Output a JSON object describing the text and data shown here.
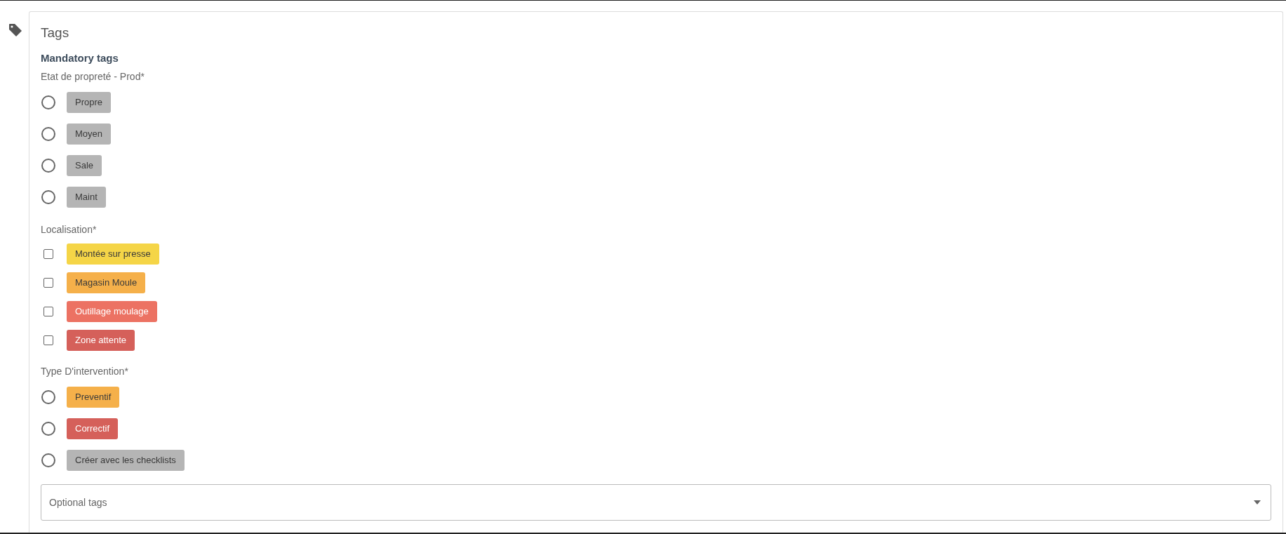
{
  "section": {
    "title": "Tags",
    "subtitle": "Mandatory tags"
  },
  "groups": [
    {
      "label": "Etat de propreté - Prod*",
      "kind": "radio",
      "options": [
        {
          "label": "Propre",
          "color": "#b5b5b5",
          "selected": false
        },
        {
          "label": "Moyen",
          "color": "#b5b5b5",
          "selected": false
        },
        {
          "label": "Sale",
          "color": "#b5b5b5",
          "selected": false
        },
        {
          "label": "Maint",
          "color": "#b5b5b5",
          "selected": false
        }
      ]
    },
    {
      "label": "Localisation*",
      "kind": "checkbox",
      "options": [
        {
          "label": "Montée sur presse",
          "color": "#f5d547",
          "checked": false
        },
        {
          "label": "Magasin Moule",
          "color": "#f5b04a",
          "checked": false
        },
        {
          "label": "Outillage moulage",
          "color": "#ec7263",
          "checked": false
        },
        {
          "label": "Zone attente",
          "color": "#d5605a",
          "checked": false
        }
      ]
    },
    {
      "label": "Type D'intervention*",
      "kind": "radio",
      "options": [
        {
          "label": "Preventif",
          "color": "#f5b04a",
          "selected": false
        },
        {
          "label": "Correctif",
          "color": "#d5605a",
          "selected": false
        },
        {
          "label": "Créer avec les checklists",
          "color": "#b5b5b5",
          "selected": false
        }
      ]
    }
  ],
  "optional": {
    "placeholder": "Optional tags"
  }
}
